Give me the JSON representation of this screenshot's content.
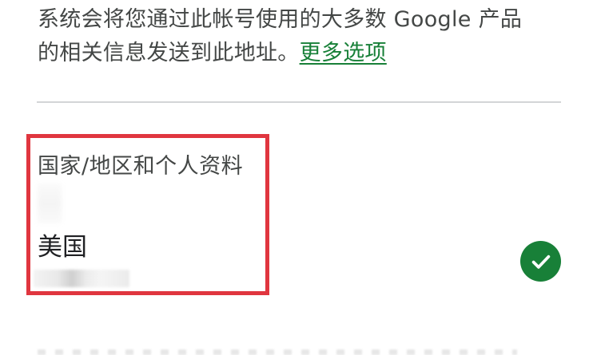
{
  "info": {
    "line1": "系统会将您通过此帐号使用的大多数 Google 产品",
    "line2": "的相关信息发送到此地址。",
    "more_options_link": "更多选项"
  },
  "section": {
    "label": "国家/地区和个人资料",
    "country_value": "美国"
  },
  "status": {
    "icon": "check-circle-icon",
    "color": "#188038"
  },
  "highlight": {
    "color": "#e0363f"
  }
}
